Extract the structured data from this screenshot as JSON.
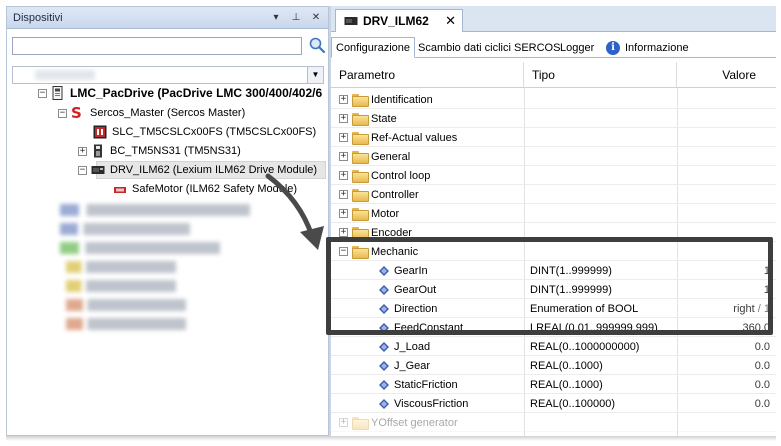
{
  "left_panel": {
    "title": "Dispositivi",
    "title_buttons": [
      "▾",
      "⊥",
      "✕"
    ],
    "search": {
      "value": "",
      "placeholder": ""
    },
    "tree": {
      "root": "LMC_PacDrive (PacDrive LMC 300/400/402/6",
      "sercos_master": "Sercos_Master (Sercos Master)",
      "slc": "SLC_TM5CSLCx00FS (TM5CSLCx00FS)",
      "bc": "BC_TM5NS31 (TM5NS31)",
      "drv": "DRV_ILM62 (Lexium ILM62 Drive Module)",
      "safe": "SafeMotor (ILM62 Safety Module)"
    }
  },
  "document": {
    "tab_label": "DRV_ILM62",
    "tab_close": "✕",
    "sub_tabs": [
      "Configurazione",
      "Scambio dati ciclici SERCOS",
      "Logger",
      "Informazione"
    ],
    "columns": {
      "param": "Parametro",
      "type": "Tipo",
      "value": "Valore"
    },
    "folders": [
      "Identification",
      "State",
      "Ref-Actual values",
      "General",
      "Control loop",
      "Controller",
      "Motor",
      "Encoder"
    ],
    "mechanic": {
      "label": "Mechanic",
      "params": [
        {
          "name": "GearIn",
          "type": "DINT(1..999999)",
          "value": "1"
        },
        {
          "name": "GearOut",
          "type": "DINT(1..999999)",
          "value": "1"
        },
        {
          "name": "Direction",
          "type": "Enumeration of BOOL",
          "value": "right",
          "value_extra": "/ 1"
        },
        {
          "name": "FeedConstant",
          "type": "LREAL(0.01..999999.999)",
          "value": "360.0"
        },
        {
          "name": "J_Load",
          "type": "REAL(0..1000000000)",
          "value": "0.0"
        },
        {
          "name": "J_Gear",
          "type": "REAL(0..1000)",
          "value": "0.0"
        },
        {
          "name": "StaticFriction",
          "type": "REAL(0..1000)",
          "value": "0.0"
        },
        {
          "name": "ViscousFriction",
          "type": "REAL(0..100000)",
          "value": "0.0"
        }
      ]
    },
    "last_folder": "YOffset generator"
  },
  "colors": {
    "highlight": "#3e3e3e",
    "selection": "#e6e6e6",
    "accent_red": "#d42020"
  }
}
